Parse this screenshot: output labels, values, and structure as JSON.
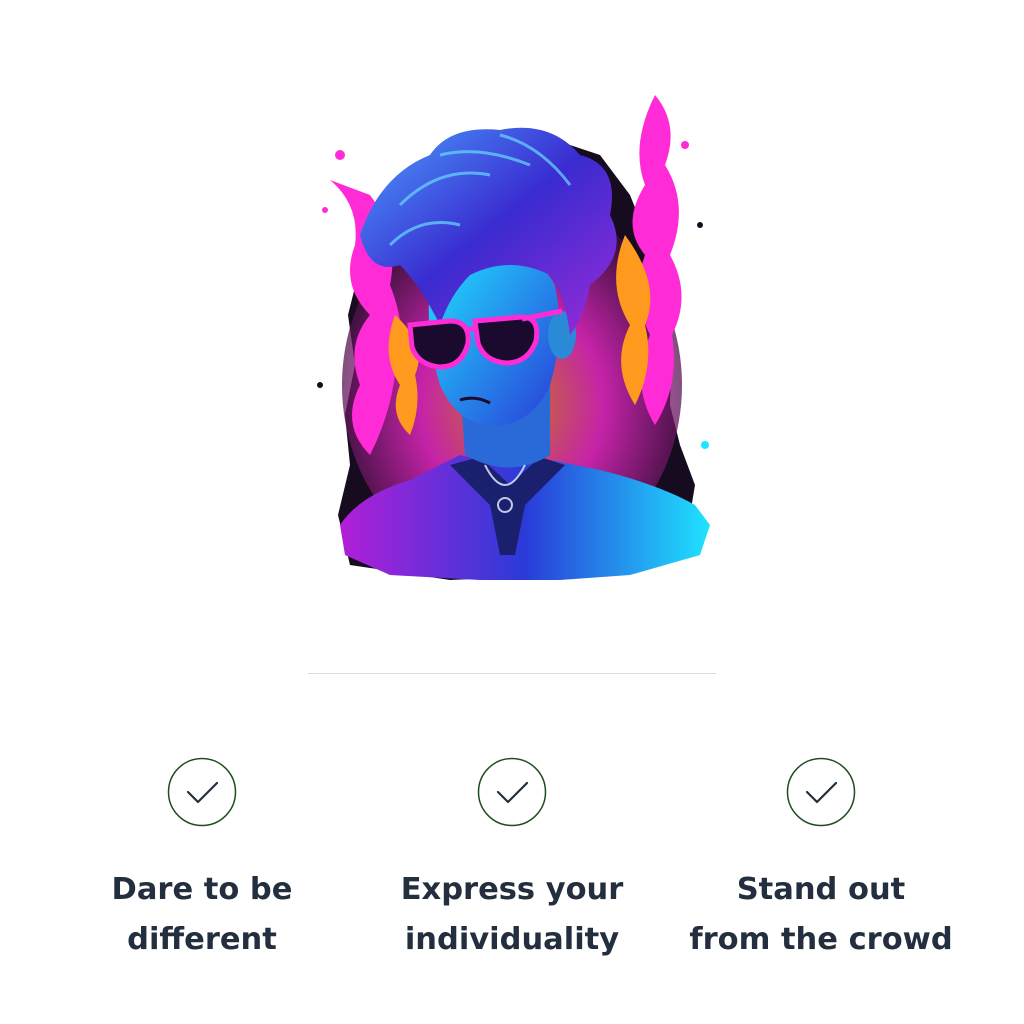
{
  "artwork": {
    "subject": "neon-portrait-illustration",
    "colors": {
      "magenta": "#ff2bd6",
      "cyan": "#1fe3ff",
      "blue": "#2a3bd8",
      "purple": "#7a1fd0",
      "orange": "#ff9a1f",
      "dark": "#160b1f"
    }
  },
  "features": [
    {
      "icon": "check-icon",
      "label": "Dare to be\ndifferent"
    },
    {
      "icon": "check-icon",
      "label": "Express your\nindividuality"
    },
    {
      "icon": "check-icon",
      "label": "Stand out\nfrom the crowd"
    }
  ],
  "colors": {
    "text": "#232f3e",
    "check": "#1f4d1f",
    "divider": "#d9dcde"
  }
}
